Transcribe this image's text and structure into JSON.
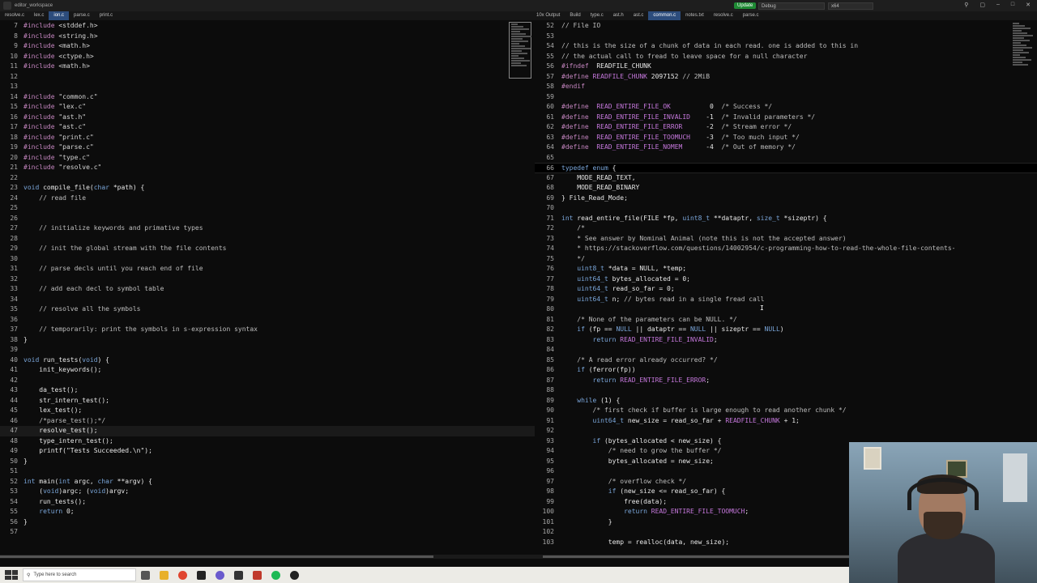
{
  "window": {
    "title": "editor_workspace",
    "update_label": "Update",
    "config_value": "Debug",
    "platform_value": "x64"
  },
  "tabs_left": [
    "resolve.c",
    "lex.c",
    "ion.c",
    "parse.c",
    "print.c"
  ],
  "tabs_left_active": 2,
  "tabs_right": [
    "10x Output",
    "Build",
    "type.c",
    "ast.h",
    "ast.c",
    "common.c",
    "notes.txt",
    "resolve.c",
    "parse.c"
  ],
  "tabs_right_active": 5,
  "left_code": [
    {
      "n": "7",
      "t": [
        [
          "pp",
          "#include "
        ],
        [
          "str",
          "<stddef.h>"
        ]
      ]
    },
    {
      "n": "8",
      "t": [
        [
          "pp",
          "#include "
        ],
        [
          "str",
          "<string.h>"
        ]
      ]
    },
    {
      "n": "9",
      "t": [
        [
          "pp",
          "#include "
        ],
        [
          "str",
          "<math.h>"
        ]
      ]
    },
    {
      "n": "10",
      "t": [
        [
          "pp",
          "#include "
        ],
        [
          "str",
          "<ctype.h>"
        ]
      ]
    },
    {
      "n": "11",
      "t": [
        [
          "pp",
          "#include "
        ],
        [
          "str",
          "<math.h>"
        ]
      ]
    },
    {
      "n": "12",
      "t": []
    },
    {
      "n": "13",
      "t": []
    },
    {
      "n": "14",
      "t": [
        [
          "pp",
          "#include "
        ],
        [
          "str",
          "\"common.c\""
        ]
      ]
    },
    {
      "n": "15",
      "t": [
        [
          "pp",
          "#include "
        ],
        [
          "str",
          "\"lex.c\""
        ]
      ]
    },
    {
      "n": "16",
      "t": [
        [
          "pp",
          "#include "
        ],
        [
          "str",
          "\"ast.h\""
        ]
      ]
    },
    {
      "n": "17",
      "t": [
        [
          "pp",
          "#include "
        ],
        [
          "str",
          "\"ast.c\""
        ]
      ]
    },
    {
      "n": "18",
      "t": [
        [
          "pp",
          "#include "
        ],
        [
          "str",
          "\"print.c\""
        ]
      ]
    },
    {
      "n": "19",
      "t": [
        [
          "pp",
          "#include "
        ],
        [
          "str",
          "\"parse.c\""
        ]
      ]
    },
    {
      "n": "20",
      "t": [
        [
          "pp",
          "#include "
        ],
        [
          "str",
          "\"type.c\""
        ]
      ]
    },
    {
      "n": "21",
      "t": [
        [
          "pp",
          "#include "
        ],
        [
          "str",
          "\"resolve.c\""
        ]
      ]
    },
    {
      "n": "22",
      "t": []
    },
    {
      "n": "23",
      "t": [
        [
          "kw",
          "void "
        ],
        [
          "fn",
          "compile_file("
        ],
        [
          "kw",
          "char "
        ],
        [
          "fn",
          "*path) {"
        ]
      ]
    },
    {
      "n": "24",
      "t": [
        [
          "cm",
          "    // read file"
        ]
      ]
    },
    {
      "n": "25",
      "t": []
    },
    {
      "n": "26",
      "t": []
    },
    {
      "n": "27",
      "t": [
        [
          "cm",
          "    // initialize keywords and primative types"
        ]
      ]
    },
    {
      "n": "28",
      "t": []
    },
    {
      "n": "29",
      "t": [
        [
          "cm",
          "    // init the global stream with the file contents"
        ]
      ]
    },
    {
      "n": "30",
      "t": []
    },
    {
      "n": "31",
      "t": [
        [
          "cm",
          "    // parse decls until you reach end of file"
        ]
      ]
    },
    {
      "n": "32",
      "t": []
    },
    {
      "n": "33",
      "t": [
        [
          "cm",
          "    // add each decl to symbol table"
        ]
      ]
    },
    {
      "n": "34",
      "t": []
    },
    {
      "n": "35",
      "t": [
        [
          "cm",
          "    // resolve all the symbols"
        ]
      ]
    },
    {
      "n": "36",
      "t": []
    },
    {
      "n": "37",
      "t": [
        [
          "cm",
          "    // temporarily: print the symbols in s-expression syntax"
        ]
      ]
    },
    {
      "n": "38",
      "t": [
        [
          "fn",
          "}"
        ]
      ]
    },
    {
      "n": "39",
      "t": []
    },
    {
      "n": "40",
      "t": [
        [
          "kw",
          "void "
        ],
        [
          "fn",
          "run_tests("
        ],
        [
          "kw",
          "void"
        ],
        [
          "fn",
          ") {"
        ]
      ]
    },
    {
      "n": "41",
      "t": [
        [
          "fn",
          "    init_keywords();"
        ]
      ]
    },
    {
      "n": "42",
      "t": []
    },
    {
      "n": "43",
      "t": [
        [
          "fn",
          "    da_test();"
        ]
      ]
    },
    {
      "n": "44",
      "t": [
        [
          "fn",
          "    str_intern_test();"
        ]
      ]
    },
    {
      "n": "45",
      "t": [
        [
          "fn",
          "    lex_test();"
        ]
      ]
    },
    {
      "n": "46",
      "t": [
        [
          "cm",
          "    /*parse_test();*/"
        ]
      ]
    },
    {
      "n": "47",
      "t": [
        [
          "fn",
          "    resolve_test();"
        ]
      ],
      "current": true
    },
    {
      "n": "48",
      "t": [
        [
          "fn",
          "    type_intern_test();"
        ]
      ]
    },
    {
      "n": "49",
      "t": [
        [
          "fn",
          "    printf(\"Tests Succeeded.\\n\");"
        ]
      ]
    },
    {
      "n": "50",
      "t": [
        [
          "fn",
          "}"
        ]
      ]
    },
    {
      "n": "51",
      "t": []
    },
    {
      "n": "52",
      "t": [
        [
          "kw",
          "int "
        ],
        [
          "fn",
          "main("
        ],
        [
          "kw",
          "int "
        ],
        [
          "fn",
          "argc, "
        ],
        [
          "kw",
          "char "
        ],
        [
          "fn",
          "**argv) {"
        ]
      ]
    },
    {
      "n": "53",
      "t": [
        [
          "fn",
          "    ("
        ],
        [
          "kw",
          "void"
        ],
        [
          "fn",
          ")argc; ("
        ],
        [
          "kw",
          "void"
        ],
        [
          "fn",
          ")argv;"
        ]
      ]
    },
    {
      "n": "54",
      "t": [
        [
          "fn",
          "    run_tests();"
        ]
      ]
    },
    {
      "n": "55",
      "t": [
        [
          "kw",
          "    return "
        ],
        [
          "fn",
          "0;"
        ]
      ]
    },
    {
      "n": "56",
      "t": [
        [
          "fn",
          "}"
        ]
      ]
    },
    {
      "n": "57",
      "t": []
    }
  ],
  "right_code": [
    {
      "n": "52",
      "t": [
        [
          "cm",
          "// File IO"
        ]
      ]
    },
    {
      "n": "53",
      "t": []
    },
    {
      "n": "54",
      "t": [
        [
          "cm",
          "// this is the size of a chunk of data in each read. one is added to this in"
        ]
      ]
    },
    {
      "n": "55",
      "t": [
        [
          "cm",
          "// the actual call to fread to leave space for a null character"
        ]
      ]
    },
    {
      "n": "56",
      "t": [
        [
          "pp",
          "#ifndef  "
        ],
        [
          "fn",
          "READFILE_CHUNK"
        ]
      ]
    },
    {
      "n": "57",
      "t": [
        [
          "pp",
          "#define "
        ],
        [
          "macro",
          "READFILE_CHUNK "
        ],
        [
          "fn",
          "2097152 "
        ],
        [
          "cm",
          "// 2MiB"
        ]
      ]
    },
    {
      "n": "58",
      "t": [
        [
          "pp",
          "#endif"
        ]
      ]
    },
    {
      "n": "59",
      "t": []
    },
    {
      "n": "60",
      "t": [
        [
          "pp",
          "#define  "
        ],
        [
          "macro",
          "READ_ENTIRE_FILE_OK          "
        ],
        [
          "fn",
          "0  "
        ],
        [
          "cm",
          "/* Success */"
        ]
      ]
    },
    {
      "n": "61",
      "t": [
        [
          "pp",
          "#define  "
        ],
        [
          "macro",
          "READ_ENTIRE_FILE_INVALID    "
        ],
        [
          "fn",
          "-1  "
        ],
        [
          "cm",
          "/* Invalid parameters */"
        ]
      ]
    },
    {
      "n": "62",
      "t": [
        [
          "pp",
          "#define  "
        ],
        [
          "macro",
          "READ_ENTIRE_FILE_ERROR      "
        ],
        [
          "fn",
          "-2  "
        ],
        [
          "cm",
          "/* Stream error */"
        ]
      ]
    },
    {
      "n": "63",
      "t": [
        [
          "pp",
          "#define  "
        ],
        [
          "macro",
          "READ_ENTIRE_FILE_TOOMUCH    "
        ],
        [
          "fn",
          "-3  "
        ],
        [
          "cm",
          "/* Too much input */"
        ]
      ]
    },
    {
      "n": "64",
      "t": [
        [
          "pp",
          "#define  "
        ],
        [
          "macro",
          "READ_ENTIRE_FILE_NOMEM      "
        ],
        [
          "fn",
          "-4  "
        ],
        [
          "cm",
          "/* Out of memory */"
        ]
      ]
    },
    {
      "n": "65",
      "t": []
    },
    {
      "n": "66",
      "t": [
        [
          "kw",
          "typedef enum "
        ],
        [
          "fn",
          "{"
        ]
      ],
      "current": true
    },
    {
      "n": "67",
      "t": [
        [
          "fn",
          "    MODE_READ_TEXT,"
        ]
      ]
    },
    {
      "n": "68",
      "t": [
        [
          "fn",
          "    MODE_READ_BINARY"
        ]
      ]
    },
    {
      "n": "69",
      "t": [
        [
          "fn",
          "} File_Read_Mode;"
        ]
      ]
    },
    {
      "n": "70",
      "t": []
    },
    {
      "n": "71",
      "t": [
        [
          "kw",
          "int "
        ],
        [
          "fn",
          "read_entire_file(FILE *fp, "
        ],
        [
          "kw",
          "uint8_t "
        ],
        [
          "fn",
          "**dataptr, "
        ],
        [
          "kw",
          "size_t "
        ],
        [
          "fn",
          "*sizeptr) {"
        ]
      ]
    },
    {
      "n": "72",
      "t": [
        [
          "cm",
          "    /*"
        ]
      ]
    },
    {
      "n": "73",
      "t": [
        [
          "cm",
          "    * See answer by Nominal Animal (note this is not the accepted answer)"
        ]
      ]
    },
    {
      "n": "74",
      "t": [
        [
          "cm",
          "    * https://stackoverflow.com/questions/14002954/c-programming-how-to-read-the-whole-file-contents-"
        ]
      ]
    },
    {
      "n": "75",
      "t": [
        [
          "cm",
          "    */"
        ]
      ]
    },
    {
      "n": "76",
      "t": [
        [
          "kw",
          "    uint8_t "
        ],
        [
          "fn",
          "*data = NULL, *temp;"
        ]
      ]
    },
    {
      "n": "77",
      "t": [
        [
          "kw",
          "    uint64_t "
        ],
        [
          "fn",
          "bytes_allocated = 0;"
        ]
      ]
    },
    {
      "n": "78",
      "t": [
        [
          "kw",
          "    uint64_t "
        ],
        [
          "fn",
          "read_so_far = 0;"
        ]
      ]
    },
    {
      "n": "79",
      "t": [
        [
          "kw",
          "    uint64_t "
        ],
        [
          "fn",
          "n; "
        ],
        [
          "cm",
          "// bytes read in a single fread call"
        ]
      ]
    },
    {
      "n": "80",
      "t": []
    },
    {
      "n": "81",
      "t": [
        [
          "cm",
          "    /* None of the parameters can be NULL. */"
        ]
      ]
    },
    {
      "n": "82",
      "t": [
        [
          "kw",
          "    if "
        ],
        [
          "fn",
          "(fp == "
        ],
        [
          "kw",
          "NULL "
        ],
        [
          "fn",
          "|| dataptr == "
        ],
        [
          "kw",
          "NULL "
        ],
        [
          "fn",
          "|| sizeptr == "
        ],
        [
          "kw",
          "NULL"
        ],
        [
          "fn",
          ")"
        ]
      ]
    },
    {
      "n": "83",
      "t": [
        [
          "kw",
          "        return "
        ],
        [
          "macro",
          "READ_ENTIRE_FILE_INVALID"
        ],
        [
          "fn",
          ";"
        ]
      ]
    },
    {
      "n": "84",
      "t": []
    },
    {
      "n": "85",
      "t": [
        [
          "cm",
          "    /* A read error already occurred? */"
        ]
      ]
    },
    {
      "n": "86",
      "t": [
        [
          "kw",
          "    if "
        ],
        [
          "fn",
          "(ferror(fp))"
        ]
      ]
    },
    {
      "n": "87",
      "t": [
        [
          "kw",
          "        return "
        ],
        [
          "macro",
          "READ_ENTIRE_FILE_ERROR"
        ],
        [
          "fn",
          ";"
        ]
      ]
    },
    {
      "n": "88",
      "t": []
    },
    {
      "n": "89",
      "t": [
        [
          "kw",
          "    while "
        ],
        [
          "fn",
          "(1) {"
        ]
      ]
    },
    {
      "n": "90",
      "t": [
        [
          "cm",
          "        /* first check if buffer is large enough to read another chunk */"
        ]
      ]
    },
    {
      "n": "91",
      "t": [
        [
          "kw",
          "        uint64_t "
        ],
        [
          "fn",
          "new_size = read_so_far + "
        ],
        [
          "macro",
          "READFILE_CHUNK "
        ],
        [
          "fn",
          "+ 1;"
        ]
      ]
    },
    {
      "n": "92",
      "t": []
    },
    {
      "n": "93",
      "t": [
        [
          "kw",
          "        if "
        ],
        [
          "fn",
          "(bytes_allocated < new_size) {"
        ]
      ]
    },
    {
      "n": "94",
      "t": [
        [
          "cm",
          "            /* need to grow the buffer */"
        ]
      ]
    },
    {
      "n": "95",
      "t": [
        [
          "fn",
          "            bytes_allocated = new_size;"
        ]
      ]
    },
    {
      "n": "96",
      "t": []
    },
    {
      "n": "97",
      "t": [
        [
          "cm",
          "            /* overflow check */"
        ]
      ]
    },
    {
      "n": "98",
      "t": [
        [
          "kw",
          "            if "
        ],
        [
          "fn",
          "(new_size <= read_so_far) {"
        ]
      ]
    },
    {
      "n": "99",
      "t": [
        [
          "fn",
          "                free(data);"
        ]
      ]
    },
    {
      "n": "100",
      "t": [
        [
          "kw",
          "                return "
        ],
        [
          "macro",
          "READ_ENTIRE_FILE_TOOMUCH"
        ],
        [
          "fn",
          ";"
        ]
      ]
    },
    {
      "n": "101",
      "t": [
        [
          "fn",
          "            }"
        ]
      ]
    },
    {
      "n": "102",
      "t": []
    },
    {
      "n": "103",
      "t": [
        [
          "fn",
          "            temp = realloc(data, new_size);"
        ]
      ]
    }
  ],
  "taskbar": {
    "search_placeholder": "Type here to search"
  },
  "colors": {
    "preprocessor": "#c586c0",
    "keyword": "#7aa6da",
    "macro": "#c678dd",
    "active_tab": "#2c4c7c",
    "update_button": "#1e8a34"
  }
}
